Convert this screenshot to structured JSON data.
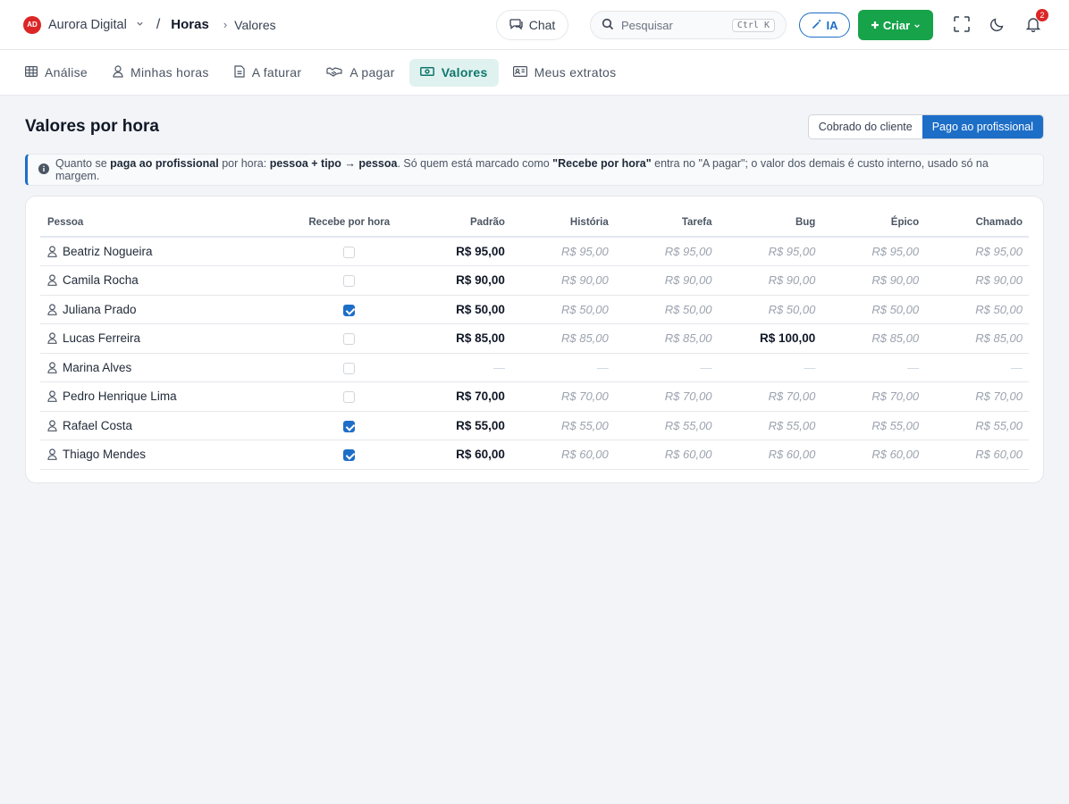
{
  "brand": {
    "logo": "AD",
    "name": "Aurora Digital"
  },
  "breadcrumb": {
    "section": "Horas",
    "page": "Valores"
  },
  "topbar": {
    "chat_label": "Chat",
    "search_placeholder": "Pesquisar",
    "search_shortcut": "Ctrl K",
    "ia_label": "IA",
    "criar_label": "Criar",
    "notification_count": "2"
  },
  "tabs": [
    {
      "label": "Análise",
      "icon": "table-icon",
      "active": false
    },
    {
      "label": "Minhas horas",
      "icon": "person-icon",
      "active": false
    },
    {
      "label": "A faturar",
      "icon": "document-icon",
      "active": false
    },
    {
      "label": "A pagar",
      "icon": "handshake-icon",
      "active": false
    },
    {
      "label": "Valores",
      "icon": "money-icon",
      "active": true
    },
    {
      "label": "Meus extratos",
      "icon": "id-card-icon",
      "active": false
    }
  ],
  "page": {
    "title": "Valores por hora",
    "toggle": {
      "options": [
        "Cobrado do cliente",
        "Pago ao profissional"
      ],
      "selected": "Pago ao profissional"
    }
  },
  "info": {
    "p1": "Quanto se ",
    "b1": "paga ao profissional",
    "p2": " por hora: ",
    "b2": "pessoa + tipo → pessoa",
    "p3": ". Só quem está marcado como ",
    "b3": "\"Recebe por hora\"",
    "p4": " entra no \"A pagar\"; o valor dos demais é custo interno, usado só na margem."
  },
  "table": {
    "columns": [
      "Pessoa",
      "Recebe por hora",
      "Padrão",
      "História",
      "Tarefa",
      "Bug",
      "Épico",
      "Chamado"
    ],
    "rows": [
      {
        "name": "Beatriz Nogueira",
        "hourly": false,
        "padrao": "R$ 95,00",
        "historia": "R$ 95,00",
        "tarefa": "R$ 95,00",
        "bug": "R$ 95,00",
        "epico": "R$ 95,00",
        "chamado": "R$ 95,00",
        "bug_override": false
      },
      {
        "name": "Camila Rocha",
        "hourly": false,
        "padrao": "R$ 90,00",
        "historia": "R$ 90,00",
        "tarefa": "R$ 90,00",
        "bug": "R$ 90,00",
        "epico": "R$ 90,00",
        "chamado": "R$ 90,00",
        "bug_override": false
      },
      {
        "name": "Juliana Prado",
        "hourly": true,
        "padrao": "R$ 50,00",
        "historia": "R$ 50,00",
        "tarefa": "R$ 50,00",
        "bug": "R$ 50,00",
        "epico": "R$ 50,00",
        "chamado": "R$ 50,00",
        "bug_override": false
      },
      {
        "name": "Lucas Ferreira",
        "hourly": false,
        "padrao": "R$ 85,00",
        "historia": "R$ 85,00",
        "tarefa": "R$ 85,00",
        "bug": "R$ 100,00",
        "epico": "R$ 85,00",
        "chamado": "R$ 85,00",
        "bug_override": true
      },
      {
        "name": "Marina Alves",
        "hourly": false,
        "padrao": "—",
        "historia": "—",
        "tarefa": "—",
        "bug": "—",
        "epico": "—",
        "chamado": "—",
        "bug_override": false
      },
      {
        "name": "Pedro Henrique Lima",
        "hourly": false,
        "padrao": "R$ 70,00",
        "historia": "R$ 70,00",
        "tarefa": "R$ 70,00",
        "bug": "R$ 70,00",
        "epico": "R$ 70,00",
        "chamado": "R$ 70,00",
        "bug_override": false
      },
      {
        "name": "Rafael Costa",
        "hourly": true,
        "padrao": "R$ 55,00",
        "historia": "R$ 55,00",
        "tarefa": "R$ 55,00",
        "bug": "R$ 55,00",
        "epico": "R$ 55,00",
        "chamado": "R$ 55,00",
        "bug_override": false
      },
      {
        "name": "Thiago Mendes",
        "hourly": true,
        "padrao": "R$ 60,00",
        "historia": "R$ 60,00",
        "tarefa": "R$ 60,00",
        "bug": "R$ 60,00",
        "epico": "R$ 60,00",
        "chamado": "R$ 60,00",
        "bug_override": false
      }
    ]
  },
  "colors": {
    "accent": "#1d6ec7",
    "primary_action": "#16a34a",
    "active_tab": "#0f766e",
    "brand": "#dc2626"
  }
}
